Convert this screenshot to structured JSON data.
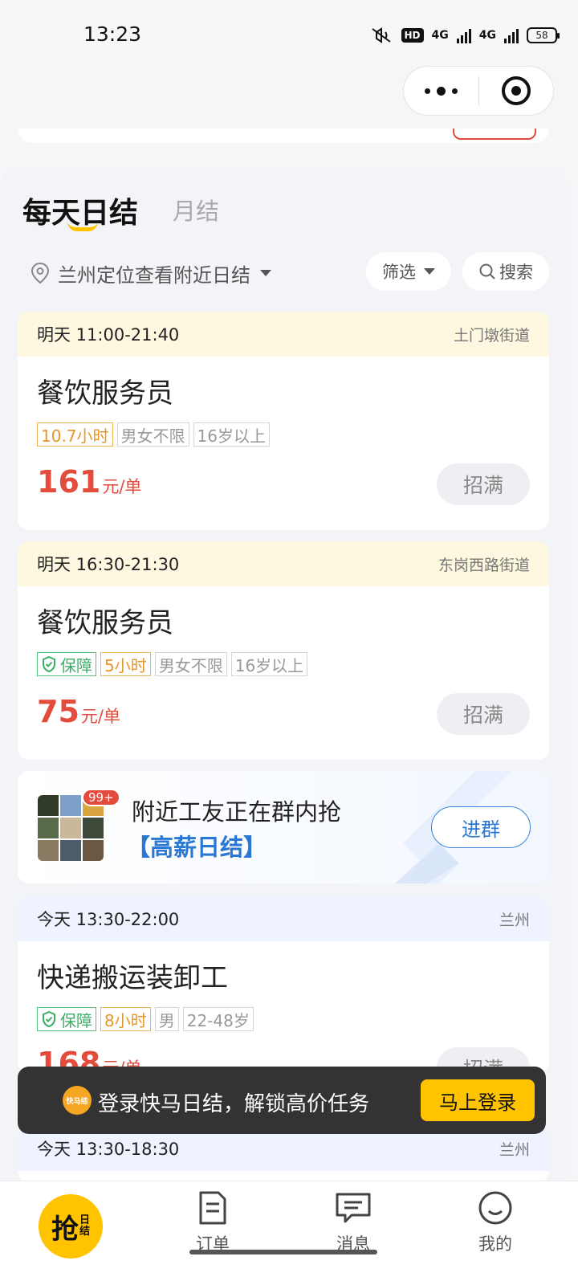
{
  "status_bar": {
    "time": "13:23",
    "hd_label": "HD",
    "network1": "4G",
    "network2": "4G",
    "battery": "58"
  },
  "capsule": {
    "more_icon": "more-dots-icon",
    "close_icon": "target-close-icon"
  },
  "tabs": {
    "daily": "每天日结",
    "monthly": "月结"
  },
  "filters": {
    "location": "兰州定位查看附近日结",
    "filter_label": "筛选",
    "search_label": "搜索"
  },
  "jobs": [
    {
      "time": "明天 11:00-21:40",
      "area": "土门墩街道",
      "title": "餐饮服务员",
      "tags": [
        "10.7小时",
        "男女不限",
        "16岁以上"
      ],
      "price": "161",
      "unit": "元/单",
      "status": "招满"
    },
    {
      "time": "明天 16:30-21:30",
      "area": "东岗西路街道",
      "title": "餐饮服务员",
      "tags": [
        "保障",
        "5小时",
        "男女不限",
        "16岁以上"
      ],
      "price": "75",
      "unit": "元/单",
      "status": "招满"
    },
    {
      "time": "今天 13:30-22:00",
      "area": "兰州",
      "title": "快递搬运装卸工",
      "tags": [
        "保障",
        "8小时",
        "男",
        "22-48岁"
      ],
      "price": "168",
      "unit": "元/单",
      "status": "招满"
    },
    {
      "time": "今天 13:30-18:30",
      "area": "兰州"
    }
  ],
  "group_banner": {
    "badge": "99+",
    "line1": "附近工友正在群内抢",
    "line2": "【高薪日结】",
    "join_label": "进群"
  },
  "login_toast": {
    "logo_text": "快马结",
    "text": "登录快马日结，解锁高价任务",
    "button": "马上登录"
  },
  "tab_bar": {
    "grab_big": "抢",
    "grab_small_1": "日",
    "grab_small_2": "结",
    "orders": "订单",
    "messages": "消息",
    "mine": "我的"
  },
  "colors": {
    "accent": "#ffc300",
    "price": "#e34b3c",
    "link_blue": "#2a78d4",
    "guarantee_green": "#3dae68",
    "hours_orange": "#e6962a"
  }
}
